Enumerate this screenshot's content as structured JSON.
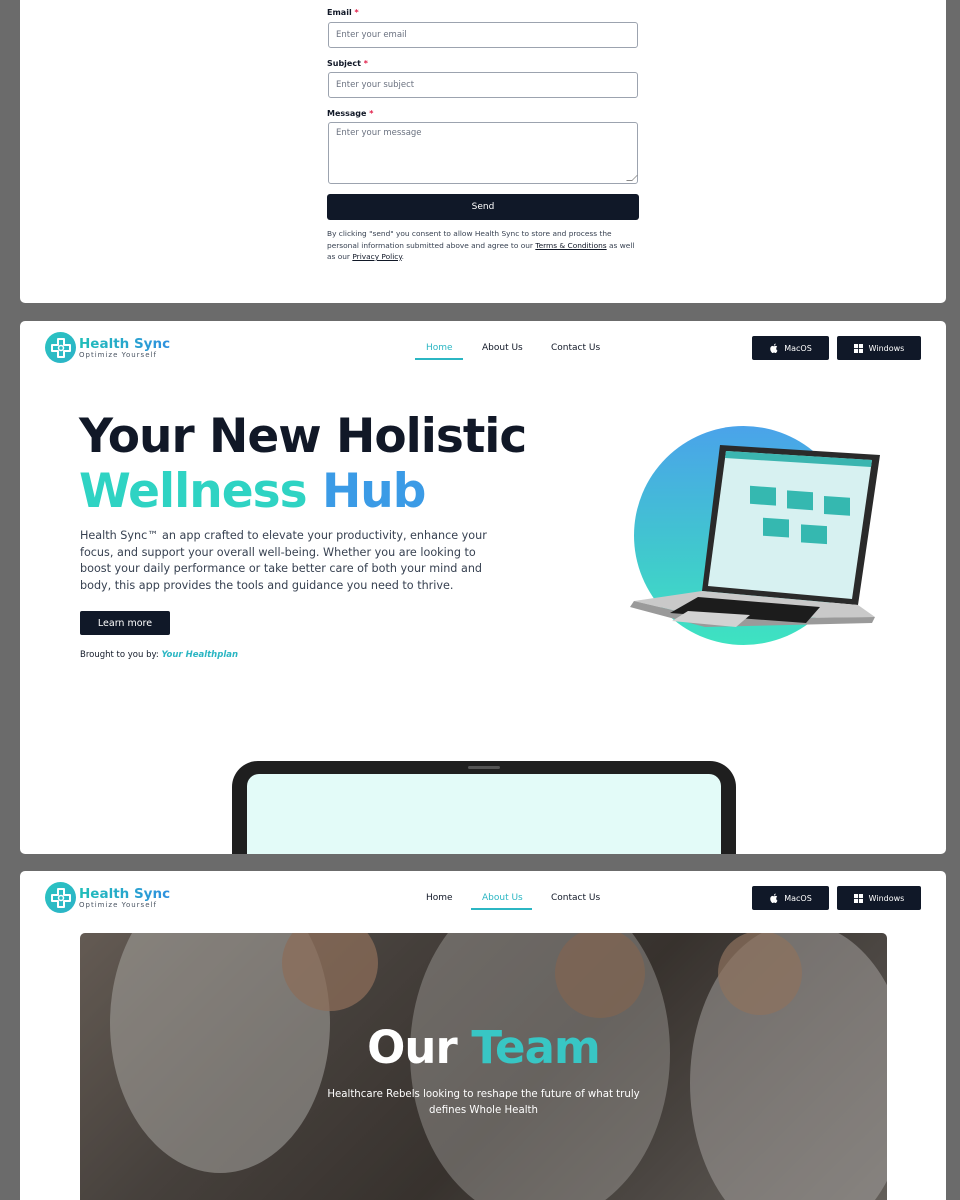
{
  "contact_form": {
    "email_label": "Email",
    "email_placeholder": "Enter your email",
    "subject_label": "Subject",
    "subject_placeholder": "Enter your subject",
    "message_label": "Message",
    "message_placeholder": "Enter your message",
    "required_mark": "*",
    "send_label": "Send",
    "consent_text_1": "By clicking \"send\" you consent to allow Health Sync to store and process the personal information submitted above and agree to our ",
    "terms_link": "Terms & Conditions",
    "consent_text_2": " as well as our ",
    "privacy_link": "Privacy Policy",
    "consent_text_3": "."
  },
  "header": {
    "logo_name": "Health Sync",
    "logo_tagline": "Optimize Yourself",
    "nav": [
      "Home",
      "About Us",
      "Contact Us"
    ],
    "macos_label": "MacOS",
    "windows_label": "Windows"
  },
  "hero": {
    "title_line1": "Your New Holistic",
    "title_word_a": "Wellness",
    "title_word_b": "Hub",
    "description": "Health Sync™ an app crafted to elevate your productivity, enhance your focus, and support your overall well-being. Whether you are looking to boost your daily performance or take better care of both your mind and body, this app provides the tools and guidance you need to thrive.",
    "learn_more_label": "Learn more",
    "brought_by_label": "Brought to you by:",
    "brought_by_name": "Your Healthplan"
  },
  "team": {
    "title_word_a": "Our",
    "title_word_b": "Team",
    "subtitle": "Healthcare Rebels looking to reshape the future of what truly defines Whole Health"
  },
  "colors": {
    "navy": "#101828",
    "teal": "#2bb6c3",
    "gradient_green": "#2fd3c3",
    "gradient_blue": "#3b9be6"
  },
  "active_nav": {
    "card_home": "Home",
    "card_about": "About Us"
  }
}
